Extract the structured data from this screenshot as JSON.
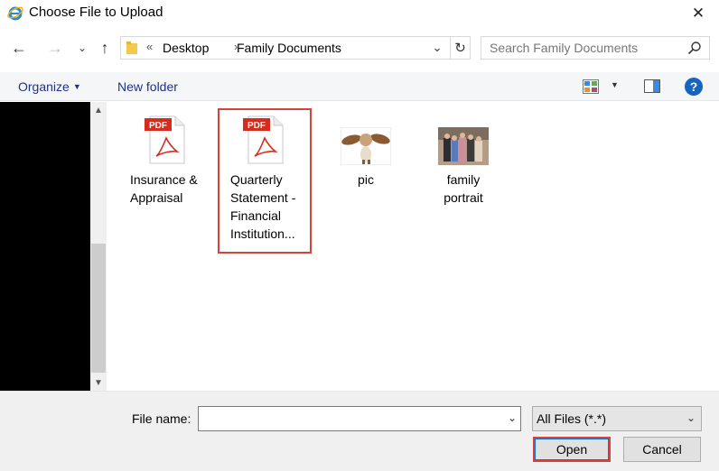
{
  "window": {
    "title": "Choose File to Upload",
    "close": "✕"
  },
  "nav": {
    "back": "←",
    "forward": "→",
    "recent": "⌄",
    "up": "↑"
  },
  "address": {
    "overflow": "«",
    "crumbs": [
      "Desktop",
      "Family Documents"
    ],
    "separator": "›",
    "dropdown": "⌄",
    "refresh": "↻"
  },
  "search": {
    "placeholder": "Search Family Documents"
  },
  "toolbar": {
    "organize": "Organize",
    "organize_caret": "▼",
    "new_folder": "New folder",
    "views_caret": "▼",
    "help": "?"
  },
  "scrollbar": {
    "up": "▲",
    "down": "▼"
  },
  "files": [
    {
      "icon": "pdf-icon",
      "badge": "PDF",
      "name": "Insurance & Appraisal",
      "lines": [
        "Insurance &",
        "Appraisal"
      ],
      "selected": false
    },
    {
      "icon": "pdf-icon",
      "badge": "PDF",
      "name": "Quarterly Statement - Financial Institution...",
      "lines": [
        "Quarterly",
        "Statement -",
        "Financial",
        "Institution..."
      ],
      "selected": true
    },
    {
      "icon": "image-thumbnail",
      "name": "pic",
      "lines": [
        "pic"
      ],
      "selected": false
    },
    {
      "icon": "image-thumbnail",
      "name": "family portrait",
      "lines": [
        "family",
        "portrait"
      ],
      "selected": false
    }
  ],
  "footer": {
    "file_name_label": "File name:",
    "file_name_value": "",
    "file_type": "All Files (*.*)",
    "open": "Open",
    "cancel": "Cancel"
  },
  "colors": {
    "accent": "#1e3287",
    "highlight_border": "#d9413d",
    "help": "#1564c0",
    "pdf_red": "#d62b1f"
  }
}
